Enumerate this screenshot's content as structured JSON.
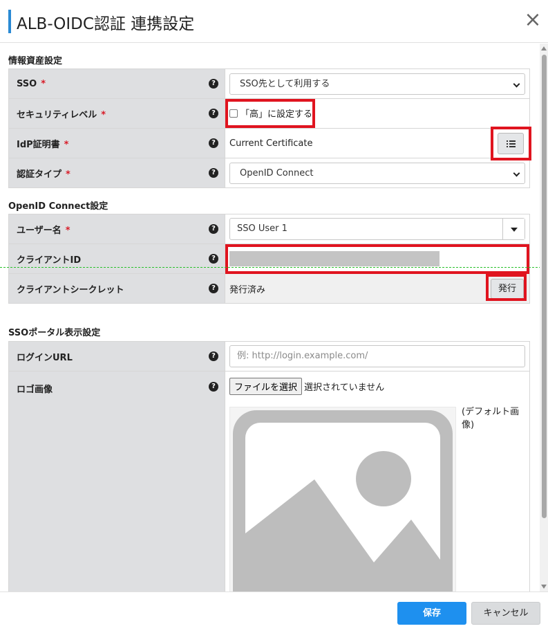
{
  "dialog": {
    "title": "ALB-OIDC認証 連携設定",
    "close_icon": "close-icon"
  },
  "sections": {
    "info": {
      "title": "情報資産設定",
      "rows": {
        "sso": {
          "label": "SSO",
          "value": "SSO先として利用する"
        },
        "security": {
          "label": "セキュリティレベル",
          "checkbox_label": "「高」に設定する",
          "checked": false
        },
        "idp": {
          "label": "IdP証明書",
          "value": "Current Certificate",
          "list_icon": "list-icon"
        },
        "auth": {
          "label": "認証タイプ",
          "value": "OpenID Connect"
        }
      }
    },
    "oidc": {
      "title": "OpenID Connect設定",
      "rows": {
        "user": {
          "label": "ユーザー名",
          "value": "SSO User 1"
        },
        "client_id": {
          "label": "クライアントID"
        },
        "secret": {
          "label": "クライアントシークレット",
          "value": "発行済み",
          "button": "発行"
        }
      }
    },
    "portal": {
      "title": "SSOポータル表示設定",
      "rows": {
        "login_url": {
          "label": "ログインURL",
          "placeholder": "例: http://login.example.com/"
        },
        "logo": {
          "label": "ロゴ画像",
          "file_button": "ファイルを選択",
          "file_status": "選択されていません",
          "default_label": "(デフォルト画像)",
          "image_icon": "image-placeholder-icon"
        }
      }
    }
  },
  "required_mark": "*",
  "help_mark": "?",
  "footer": {
    "save": "保存",
    "cancel": "キャンセル"
  },
  "colors": {
    "accent": "#2a8ad4",
    "primary_button": "#1e90ef",
    "required": "#d81b27",
    "highlight_box": "#e0141f"
  }
}
